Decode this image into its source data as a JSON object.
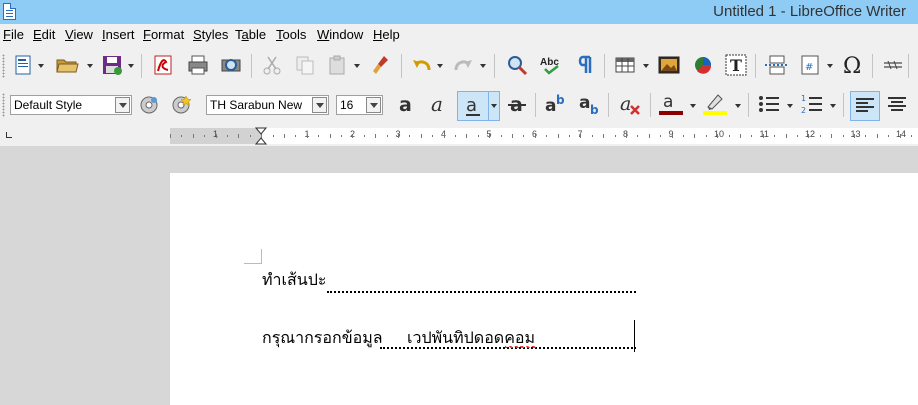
{
  "window": {
    "title": "Untitled 1 - LibreOffice Writer",
    "icon": "writer-document-icon"
  },
  "menu": [
    {
      "label": "File",
      "accel": "F",
      "rest": "ile"
    },
    {
      "label": "Edit",
      "accel": "E",
      "rest": "dit"
    },
    {
      "label": "View",
      "accel": "V",
      "rest": "iew"
    },
    {
      "label": "Insert",
      "accel": "I",
      "rest": "nsert"
    },
    {
      "label": "Format",
      "accel": "F",
      "rest": "ormat",
      "pre": ""
    },
    {
      "label": "Styles",
      "accel": "S",
      "rest": "tyles"
    },
    {
      "label": "Table",
      "pre": "T",
      "accel": "a",
      "rest": "ble"
    },
    {
      "label": "Tools",
      "accel": "T",
      "rest": "ools"
    },
    {
      "label": "Window",
      "accel": "W",
      "rest": "indow"
    },
    {
      "label": "Help",
      "accel": "H",
      "rest": "elp"
    }
  ],
  "formatting": {
    "paragraph_style": "Default Style",
    "font_name": "TH Sarabun New",
    "font_size": "16",
    "active_buttons": [
      "underline",
      "align-left"
    ]
  },
  "ruler": {
    "numbers": [
      "1",
      "1",
      "2",
      "3",
      "4",
      "5",
      "6",
      "7",
      "8",
      "9",
      "10",
      "11",
      "12",
      "13",
      "14"
    ]
  },
  "document": {
    "line1_label": "ทำเส้นปะ",
    "line2_label": "กรุณากรอกข้อมูล",
    "line2_value": "เวปพันทิปดอดคอม"
  },
  "colors": {
    "titlebar": "#8ecbf5",
    "font_color": "#8b0000",
    "highlight": "#ffff00"
  }
}
